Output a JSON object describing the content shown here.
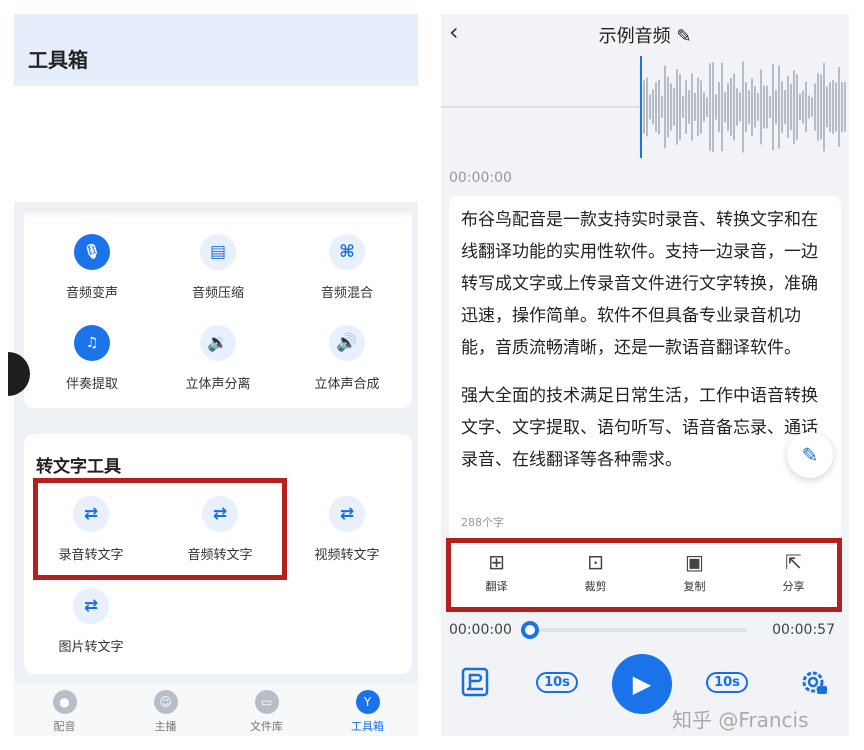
{
  "left": {
    "header_title": "工具箱",
    "audio_tools": [
      {
        "label": "音频变声",
        "icon": "mic-icon",
        "glyph": "🎙"
      },
      {
        "label": "音频压缩",
        "icon": "compress-icon",
        "glyph": "▤"
      },
      {
        "label": "音频混合",
        "icon": "mix-icon",
        "glyph": "⌘"
      },
      {
        "label": "伴奏提取",
        "icon": "extract-icon",
        "glyph": "♫"
      },
      {
        "label": "立体声分离",
        "icon": "stereo-split-icon",
        "glyph": "🔉"
      },
      {
        "label": "立体声合成",
        "icon": "stereo-merge-icon",
        "glyph": "🔊"
      }
    ],
    "text_section_title": "转文字工具",
    "text_tools": [
      {
        "label": "录音转文字",
        "icon": "record-to-text-icon",
        "glyph": "⇄"
      },
      {
        "label": "音频转文字",
        "icon": "audio-to-text-icon",
        "glyph": "⇄"
      },
      {
        "label": "视频转文字",
        "icon": "video-to-text-icon",
        "glyph": "⇄"
      },
      {
        "label": "图片转文字",
        "icon": "image-to-text-icon",
        "glyph": "⇄"
      }
    ],
    "tabs": [
      {
        "label": "配音",
        "icon": "dub-icon",
        "glyph": "●"
      },
      {
        "label": "主播",
        "icon": "anchor-icon",
        "glyph": "☺"
      },
      {
        "label": "文件库",
        "icon": "files-icon",
        "glyph": "▭"
      },
      {
        "label": "工具箱",
        "icon": "toolbox-icon",
        "glyph": "Y"
      }
    ]
  },
  "right": {
    "back": "‹",
    "title": "示例音频",
    "edit_glyph": "✎",
    "time_label": "00:00:00",
    "paragraph1": "布谷鸟配音是一款支持实时录音、转换文字和在线翻译功能的实用性软件。支持一边录音，一边转写成文字或上传录音文件进行文字转换，准确迅速，操作简单。软件不但具备专业录音机功能，音质流畅清晰，还是一款语音翻译软件。",
    "paragraph2": "强大全面的技术满足日常生活，工作中语音转换文字、文字提取、语句听写、语音备忘录、通话录音、在线翻译等各种需求。",
    "char_count": "288个字",
    "actions": [
      {
        "label": "翻译",
        "icon": "translate-icon",
        "glyph": "⊞"
      },
      {
        "label": "裁剪",
        "icon": "crop-icon",
        "glyph": "⊡"
      },
      {
        "label": "复制",
        "icon": "copy-icon",
        "glyph": "▣"
      },
      {
        "label": "分享",
        "icon": "share-icon",
        "glyph": "⇱"
      }
    ],
    "player": {
      "current_time": "00:00:00",
      "total_time": "00:00:57",
      "rewind_label": "10s",
      "forward_label": "10s",
      "play_glyph": "▶",
      "progress": 0
    }
  },
  "watermark": "知乎 @Francis",
  "colors": {
    "accent": "#1a73e8",
    "highlight": "#b3201d"
  }
}
